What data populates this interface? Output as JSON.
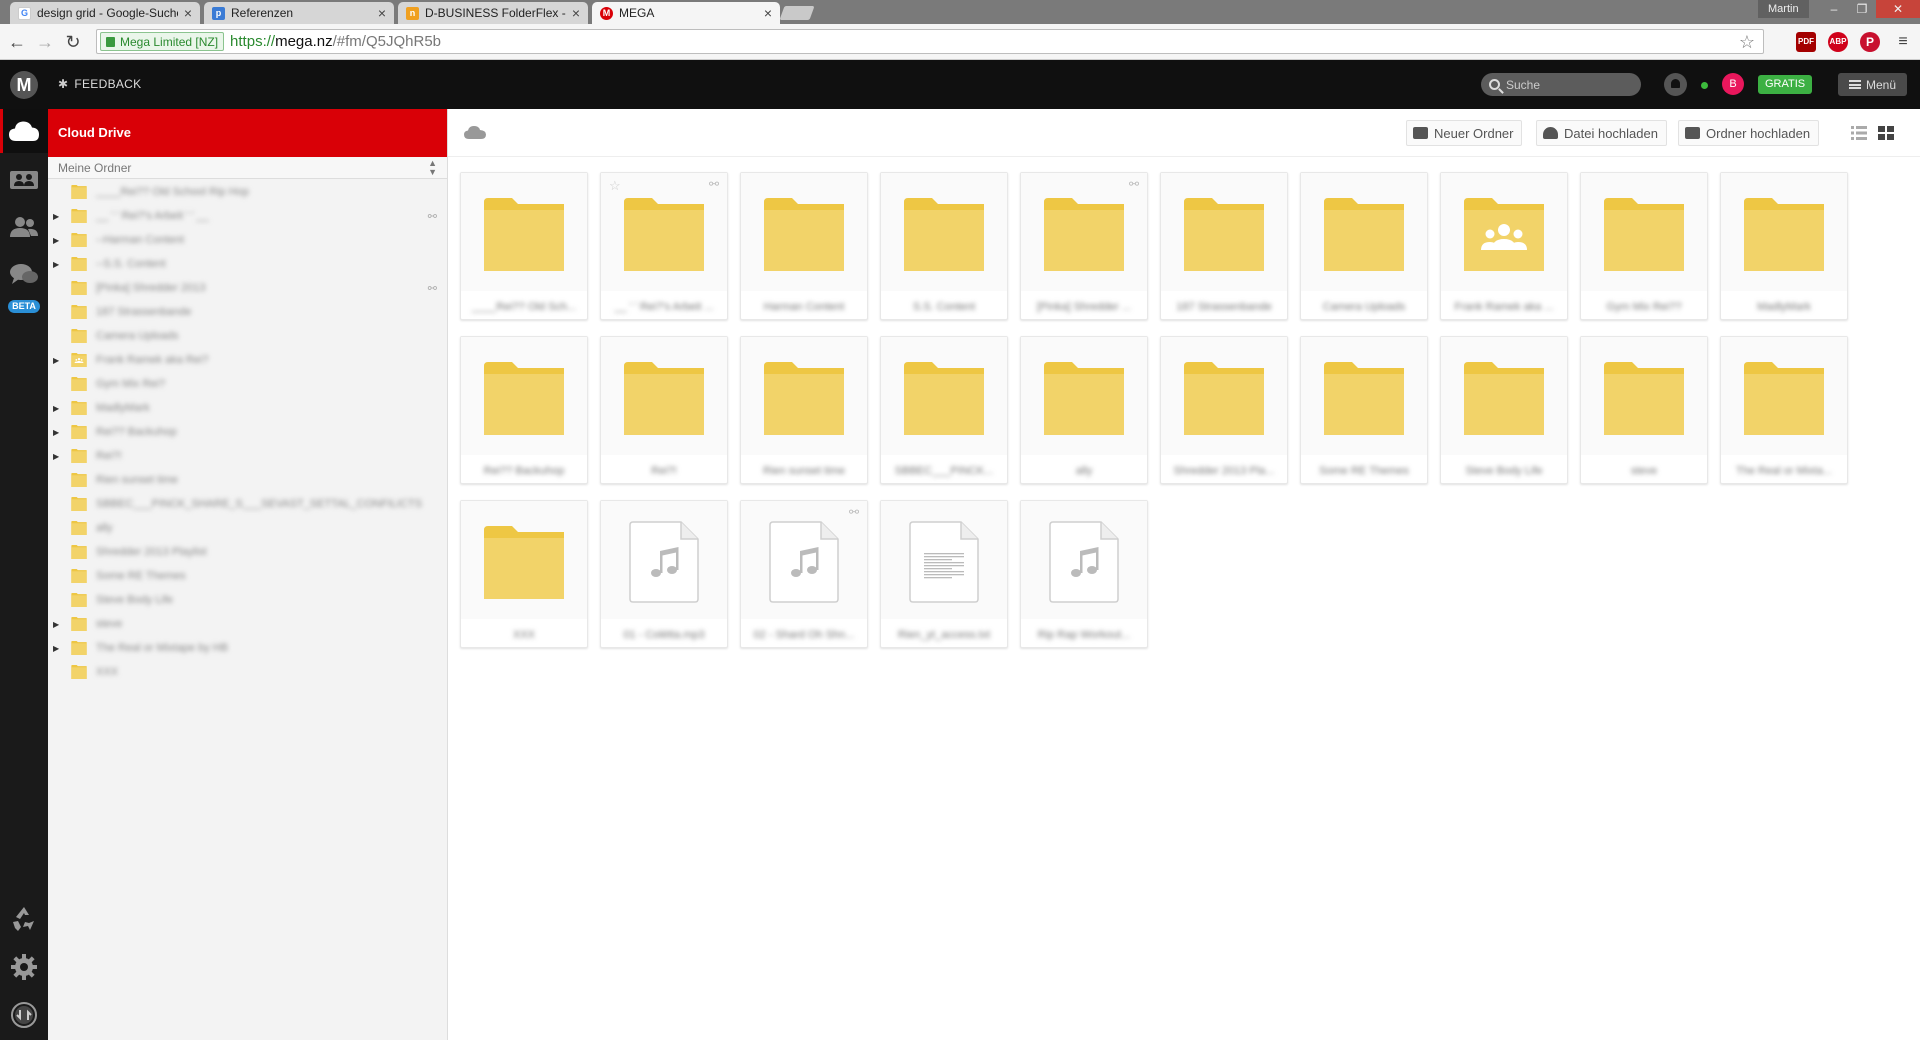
{
  "browser": {
    "tabs": [
      {
        "title": "design grid - Google-Suche",
        "favicon": "google-favicon",
        "active": false
      },
      {
        "title": "Referenzen",
        "favicon": "site-favicon",
        "active": false
      },
      {
        "title": "D-BUSINESS FolderFlex - F",
        "favicon": "orange-favicon",
        "active": false
      },
      {
        "title": "MEGA",
        "favicon": "mega-favicon",
        "active": true
      }
    ],
    "user": "Martin",
    "security_label": "Mega Limited [NZ]",
    "url_scheme": "https://",
    "url_host": "mega.nz",
    "url_path": "/#fm/Q5JQhR5b"
  },
  "header": {
    "logo": "M",
    "feedback_label": "FEEDBACK",
    "search_placeholder": "Suche",
    "avatar_initial": "B",
    "plan_badge": "GRATIS",
    "menu_label": "Menü",
    "accent_color": "#d90007"
  },
  "rail": {
    "beta_label": "BETA",
    "items": [
      "cloud-drive-icon",
      "shared-icon",
      "contacts-icon",
      "chat-icon",
      "rubbish-bin-icon",
      "settings-icon",
      "transfers-icon"
    ]
  },
  "tree": {
    "title": "Cloud Drive",
    "subtitle": "Meine Ordner",
    "items": [
      {
        "name": "____Rei?? Old School Rip Hop",
        "expandable": false,
        "shared": false,
        "link": false
      },
      {
        "name": "__ ' ' Rei?'s Arbeit ' ' __",
        "expandable": true,
        "shared": false,
        "link": true
      },
      {
        "name": "--Harman Content",
        "expandable": true,
        "shared": false,
        "link": false
      },
      {
        "name": "--S.S. Content",
        "expandable": true,
        "shared": false,
        "link": false
      },
      {
        "name": "[Pinka] Shredder 2013",
        "expandable": false,
        "shared": false,
        "link": true
      },
      {
        "name": "187 Strassenbande",
        "expandable": false,
        "shared": false,
        "link": false
      },
      {
        "name": "Camera Uploads",
        "expandable": false,
        "shared": false,
        "link": false
      },
      {
        "name": "Frank Ramek aka Rei?",
        "expandable": true,
        "shared": true,
        "link": false
      },
      {
        "name": "Gym Mix Rei?",
        "expandable": false,
        "shared": false,
        "link": false
      },
      {
        "name": "MadlyMark",
        "expandable": true,
        "shared": false,
        "link": false
      },
      {
        "name": "Rei?? Backuhop",
        "expandable": true,
        "shared": false,
        "link": false
      },
      {
        "name": "Rei?!",
        "expandable": true,
        "shared": false,
        "link": false
      },
      {
        "name": "Rien sunset time",
        "expandable": false,
        "shared": false,
        "link": false
      },
      {
        "name": "SBBEC___PINCK_SHARE_S___SEVAST_SETTAL_CONFILICTS",
        "expandable": false,
        "shared": false,
        "link": false
      },
      {
        "name": "ally",
        "expandable": false,
        "shared": false,
        "link": false
      },
      {
        "name": "Shredder 2013 Playlist",
        "expandable": false,
        "shared": false,
        "link": false
      },
      {
        "name": "Some RE Themes",
        "expandable": false,
        "shared": false,
        "link": false
      },
      {
        "name": "Steve Body Life",
        "expandable": false,
        "shared": false,
        "link": false
      },
      {
        "name": "steve",
        "expandable": true,
        "shared": false,
        "link": false
      },
      {
        "name": "The Real or Mixtape by HB",
        "expandable": true,
        "shared": false,
        "link": false
      },
      {
        "name": "XXX",
        "expandable": false,
        "shared": false,
        "link": false
      }
    ]
  },
  "toolbar": {
    "new_folder": "Neuer Ordner",
    "upload_file": "Datei hochladen",
    "upload_folder": "Ordner hochladen"
  },
  "grid": {
    "items": [
      {
        "name": "____Rei?? Old Sch...",
        "type": "folder",
        "star": false,
        "link": false
      },
      {
        "name": "__ ' ' Rei?'s Arbeit ...",
        "type": "folder",
        "star": true,
        "link": true
      },
      {
        "name": "Harman Content",
        "type": "folder",
        "star": false,
        "link": false
      },
      {
        "name": "S.S. Content",
        "type": "folder",
        "star": false,
        "link": false
      },
      {
        "name": "[Pinka] Shredder ...",
        "type": "folder",
        "star": false,
        "link": true
      },
      {
        "name": "187 Strassenbande",
        "type": "folder",
        "star": false,
        "link": false
      },
      {
        "name": "Camera Uploads",
        "type": "folder",
        "star": false,
        "link": false
      },
      {
        "name": "Frank Ramek aka ...",
        "type": "shared-folder",
        "star": false,
        "link": false
      },
      {
        "name": "Gym Mix Rei??",
        "type": "folder",
        "star": false,
        "link": false
      },
      {
        "name": "MadlyMark",
        "type": "folder",
        "star": false,
        "link": false
      },
      {
        "name": "Rei?? Backuhop",
        "type": "folder",
        "star": false,
        "link": false
      },
      {
        "name": "Rei?!",
        "type": "folder",
        "star": false,
        "link": false
      },
      {
        "name": "Rien sunset time",
        "type": "folder",
        "star": false,
        "link": false
      },
      {
        "name": "SBBEC___PINCK...",
        "type": "folder",
        "star": false,
        "link": false
      },
      {
        "name": "ally",
        "type": "folder",
        "star": false,
        "link": false
      },
      {
        "name": "Shredder 2013 Pla...",
        "type": "folder",
        "star": false,
        "link": false
      },
      {
        "name": "Some RE Themes",
        "type": "folder",
        "star": false,
        "link": false
      },
      {
        "name": "Steve Body Life",
        "type": "folder",
        "star": false,
        "link": false
      },
      {
        "name": "steve",
        "type": "folder",
        "star": false,
        "link": false
      },
      {
        "name": "The Real or Mixta...",
        "type": "folder",
        "star": false,
        "link": false
      },
      {
        "name": "XXX",
        "type": "folder",
        "star": false,
        "link": false
      },
      {
        "name": "01 - Colétta.mp3",
        "type": "audio",
        "star": false,
        "link": false
      },
      {
        "name": "02 - Shard Oh Shn...",
        "type": "audio",
        "star": false,
        "link": true
      },
      {
        "name": "Rien_yt_access.txt",
        "type": "text",
        "star": false,
        "link": false
      },
      {
        "name": "Rip Rap Workout...",
        "type": "audio",
        "star": false,
        "link": false
      }
    ]
  },
  "colors": {
    "folder": "#f2d369",
    "folder_tab": "#eec744",
    "accent_red": "#d90007",
    "online_green": "#3cba3c",
    "gratis_green": "#3cb043",
    "avatar_pink": "#e9175c"
  }
}
